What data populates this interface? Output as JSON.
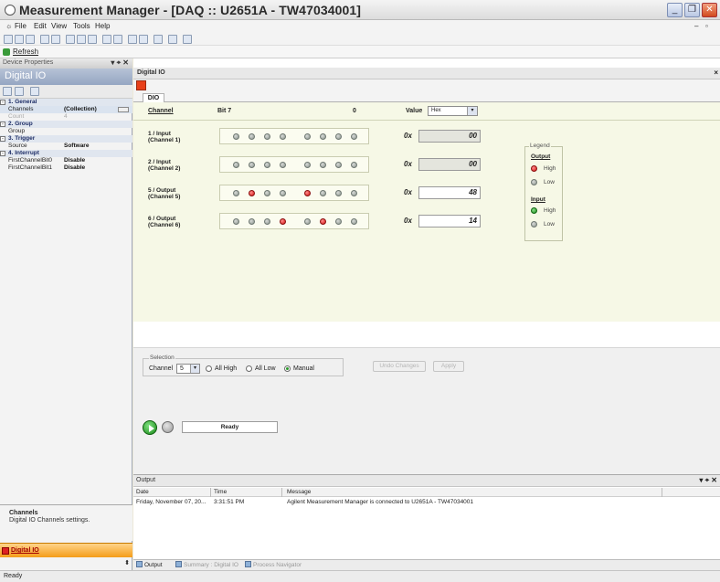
{
  "window": {
    "title": "Measurement Manager - [DAQ :: U2651A - TW47034001]"
  },
  "menu": {
    "items": [
      "File",
      "Edit",
      "View",
      "Tools",
      "Help"
    ]
  },
  "toolbar": {
    "refresh_label": "Refresh"
  },
  "left_panel": {
    "header": "Device Properties",
    "header_controls": "▾ ⌖ ✕",
    "banner": "Digital IO",
    "properties": [
      {
        "kind": "cat",
        "box": "-",
        "label": "1. General"
      },
      {
        "kind": "row",
        "key": "Channels",
        "value": "(Collection)",
        "selected": true
      },
      {
        "kind": "row",
        "key": "Count",
        "value": "4",
        "dim": true
      },
      {
        "kind": "cat",
        "box": "-",
        "label": "2. Group"
      },
      {
        "kind": "row",
        "key": "Group",
        "value": ""
      },
      {
        "kind": "cat",
        "box": "-",
        "label": "3. Trigger"
      },
      {
        "kind": "row",
        "key": "Source",
        "value": "Software"
      },
      {
        "kind": "cat",
        "box": "-",
        "label": "4. Interrupt"
      },
      {
        "kind": "row",
        "key": "FirstChannelBit0",
        "value": "Disable"
      },
      {
        "kind": "row",
        "key": "FirstChannelBit1",
        "value": "Disable"
      }
    ],
    "desc_title": "Channels",
    "desc_text": "Digital IO Channels settings.",
    "bottom_tab": "Digital IO"
  },
  "main": {
    "header": "Digital IO",
    "tab": "DIO",
    "columns": {
      "channel": "Channel",
      "bit7": "Bit 7",
      "bit0": "0",
      "value": "Value",
      "format": "Hex"
    },
    "channels": [
      {
        "line1": "1 / Input",
        "line2": "(Channel 1)",
        "bits": [
          0,
          0,
          0,
          0,
          0,
          0,
          0,
          0
        ],
        "prefix": "0x",
        "value": "00",
        "editable": false
      },
      {
        "line1": "2 / Input",
        "line2": "(Channel 2)",
        "bits": [
          0,
          0,
          0,
          0,
          0,
          0,
          0,
          0
        ],
        "prefix": "0x",
        "value": "00",
        "editable": false
      },
      {
        "line1": "5 / Output",
        "line2": "(Channel 5)",
        "bits": [
          0,
          1,
          0,
          0,
          1,
          0,
          0,
          0
        ],
        "prefix": "0x",
        "value": "48",
        "editable": true
      },
      {
        "line1": "6 / Output",
        "line2": "(Channel 6)",
        "bits": [
          0,
          0,
          0,
          1,
          0,
          1,
          0,
          0
        ],
        "prefix": "0x",
        "value": "14",
        "editable": true
      }
    ],
    "legend": {
      "caption": "Legend",
      "output_label": "Output",
      "input_label": "Input",
      "high": "High",
      "low": "Low"
    },
    "selection": {
      "caption": "Selection",
      "channel_label": "Channel",
      "channel_value": "5",
      "all_high": "All High",
      "all_low": "All Low",
      "manual": "Manual",
      "undo": "Undo Changes",
      "apply": "Apply"
    },
    "status": "Ready"
  },
  "output": {
    "header": "Output",
    "header_controls": "▾ ⌖ ✕",
    "columns": [
      "Date",
      "Time",
      "Message"
    ],
    "rows": [
      {
        "date": "Friday, November 07, 20...",
        "time": "3:31:51 PM",
        "message": "Agilent Measurement Manager is connected to U2651A - TW47034001"
      }
    ]
  },
  "bottom_tabs": [
    "Output",
    "Summary : Digital IO",
    "Process Navigator"
  ],
  "statusbar": "Ready",
  "colors": {
    "led_high_output": "#d41212",
    "led_high_input": "#1b8a1b",
    "led_low": "#8b948d",
    "accent_tab": "#f49c18"
  }
}
